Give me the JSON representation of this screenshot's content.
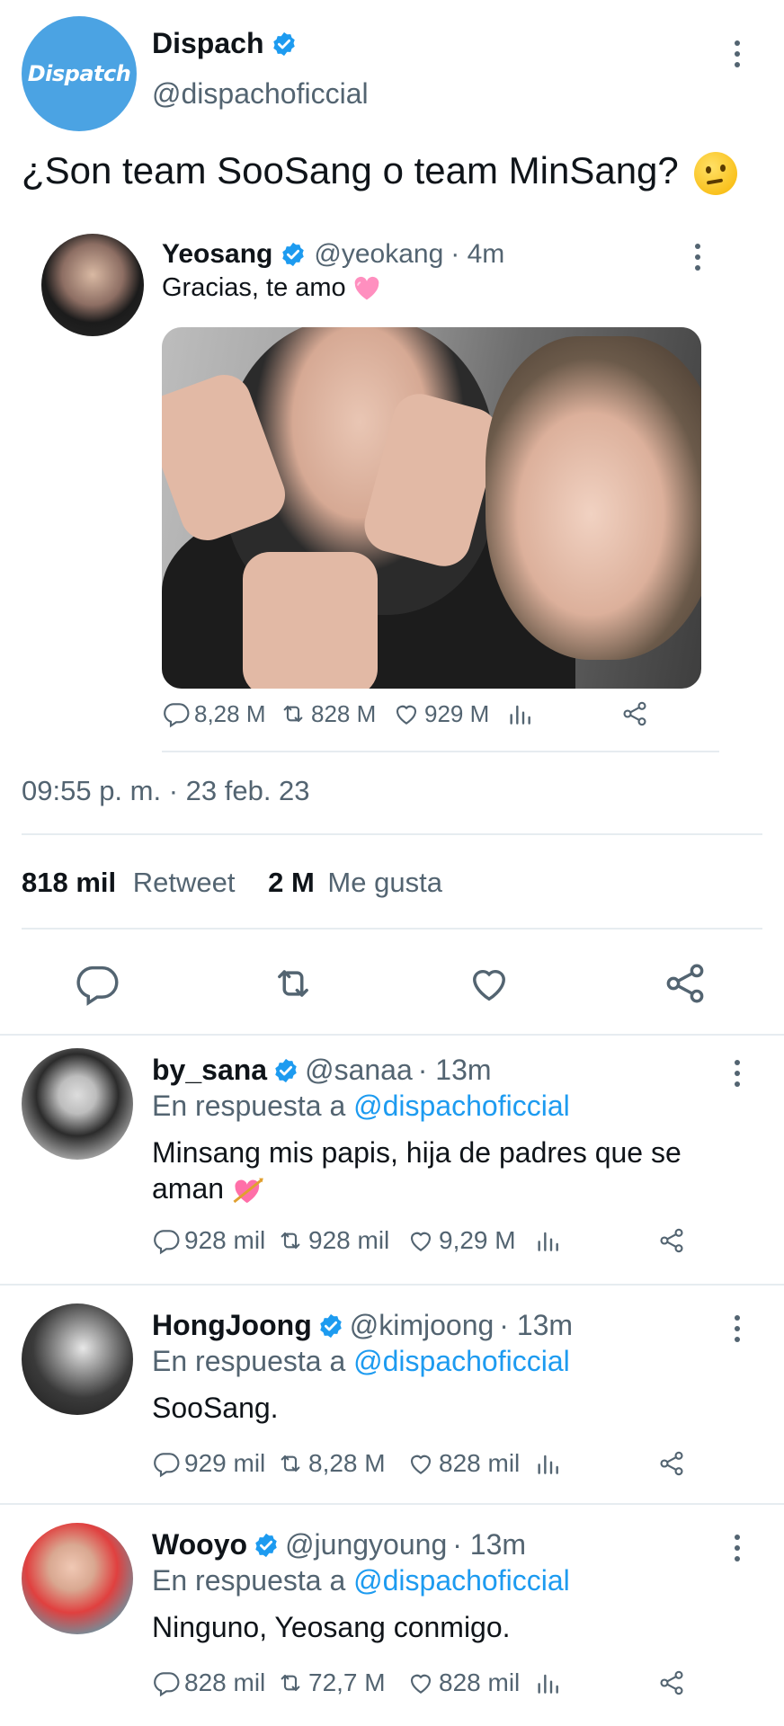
{
  "main_tweet": {
    "author": {
      "name": "Dispach",
      "handle": "@dispachoficcial",
      "avatar_text": "Dispatch"
    },
    "text": "¿Son team SooSang o team MinSang?",
    "text_emoji": "thinking-face-emoji",
    "quoted": {
      "name": "Yeosang",
      "handle": "@yeokang",
      "time": "· 4m",
      "text": "Gracias, te amo",
      "text_emoji": "pink-heart-emoji",
      "actions": {
        "replies": "8,28 M",
        "retweets": "828 M",
        "likes": "929 M"
      }
    },
    "timestamp": "09:55 p. m. · 23 feb. 23",
    "stats": {
      "retweets_count": "818 mil",
      "retweets_label": "Retweet",
      "likes_count": "2 M",
      "likes_label": "Me gusta"
    }
  },
  "replies": [
    {
      "name": "by_sana",
      "handle": "@sanaa",
      "time": "· 13m",
      "reply_prefix": "En respuesta a",
      "reply_mention": "@dispachoficcial",
      "text": "Minsang mis papis, hija de padres que se aman",
      "text_emoji": "heart-with-arrow-emoji",
      "actions": {
        "replies": "928 mil",
        "retweets": "928 mil",
        "likes": "9,29 M"
      }
    },
    {
      "name": "HongJoong",
      "handle": "@kimjoong",
      "time": "· 13m",
      "reply_prefix": "En respuesta a",
      "reply_mention": "@dispachoficcial",
      "text": "SooSang.",
      "actions": {
        "replies": "929 mil",
        "retweets": "8,28 M",
        "likes": "828 mil"
      }
    },
    {
      "name": "Wooyo",
      "handle": "@jungyoung",
      "time": "· 13m",
      "reply_prefix": "En respuesta a",
      "reply_mention": "@dispachoficcial",
      "text": "Ninguno, Yeosang conmigo.",
      "actions": {
        "replies": "828 mil",
        "retweets": "72,7 M",
        "likes": "828 mil"
      }
    }
  ],
  "colors": {
    "accent": "#1d9bf0",
    "muted": "#536471",
    "text": "#0f1419",
    "divider": "#e6ecf0",
    "dispatch_avatar": "#4ba3e3"
  }
}
